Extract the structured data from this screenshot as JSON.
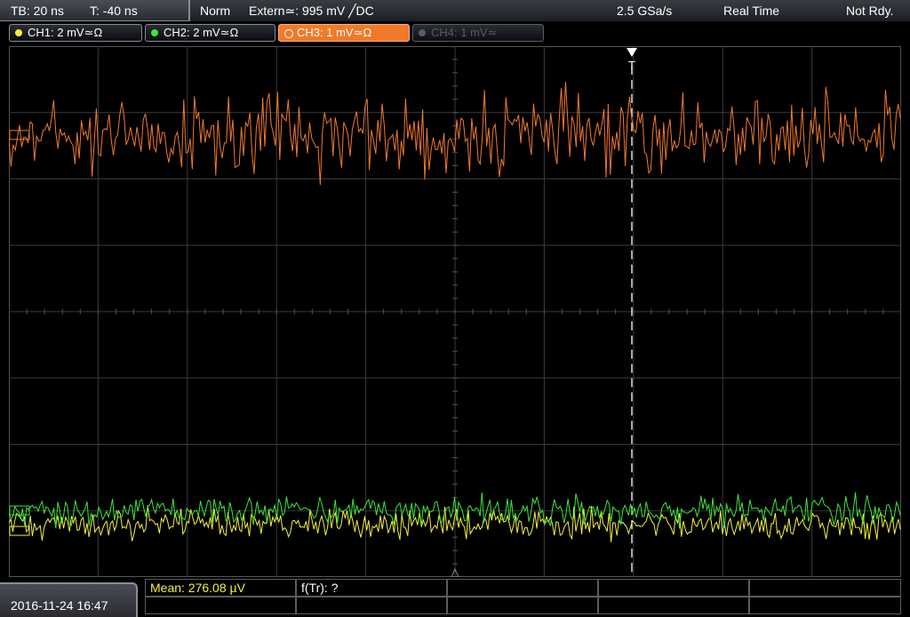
{
  "status": {
    "timebase": "TB: 20 ns",
    "trigger_time": "T: -40 ns",
    "mode": "Norm",
    "trigger": "Extern≃: 995 mV ╱DC",
    "sample_rate": "2.5 GSa/s",
    "acquisition": "Real Time",
    "ready": "Not Rdy."
  },
  "channels": [
    {
      "label": "CH1: 2 mV≃Ω",
      "color": "#f5f03c",
      "state": "on"
    },
    {
      "label": "CH2: 2 mV≃Ω",
      "color": "#3ce63c",
      "state": "on"
    },
    {
      "label": "CH3: 1 mV≃Ω",
      "color": "#f07a2a",
      "state": "active"
    },
    {
      "label": "CH4: 1 mV≃",
      "color": "#5a5c62",
      "state": "off"
    }
  ],
  "trigger_marker": "T",
  "footer": {
    "date": "2016-11-24 16:47",
    "measurement_mean": "Mean: 276.08 µV",
    "measurement_freq": "f(Tr): ?"
  },
  "colors": {
    "ch1": "#f5f03c",
    "ch2": "#3ce63c",
    "ch3": "#f07a2a",
    "grid": "#3a3a3a"
  }
}
